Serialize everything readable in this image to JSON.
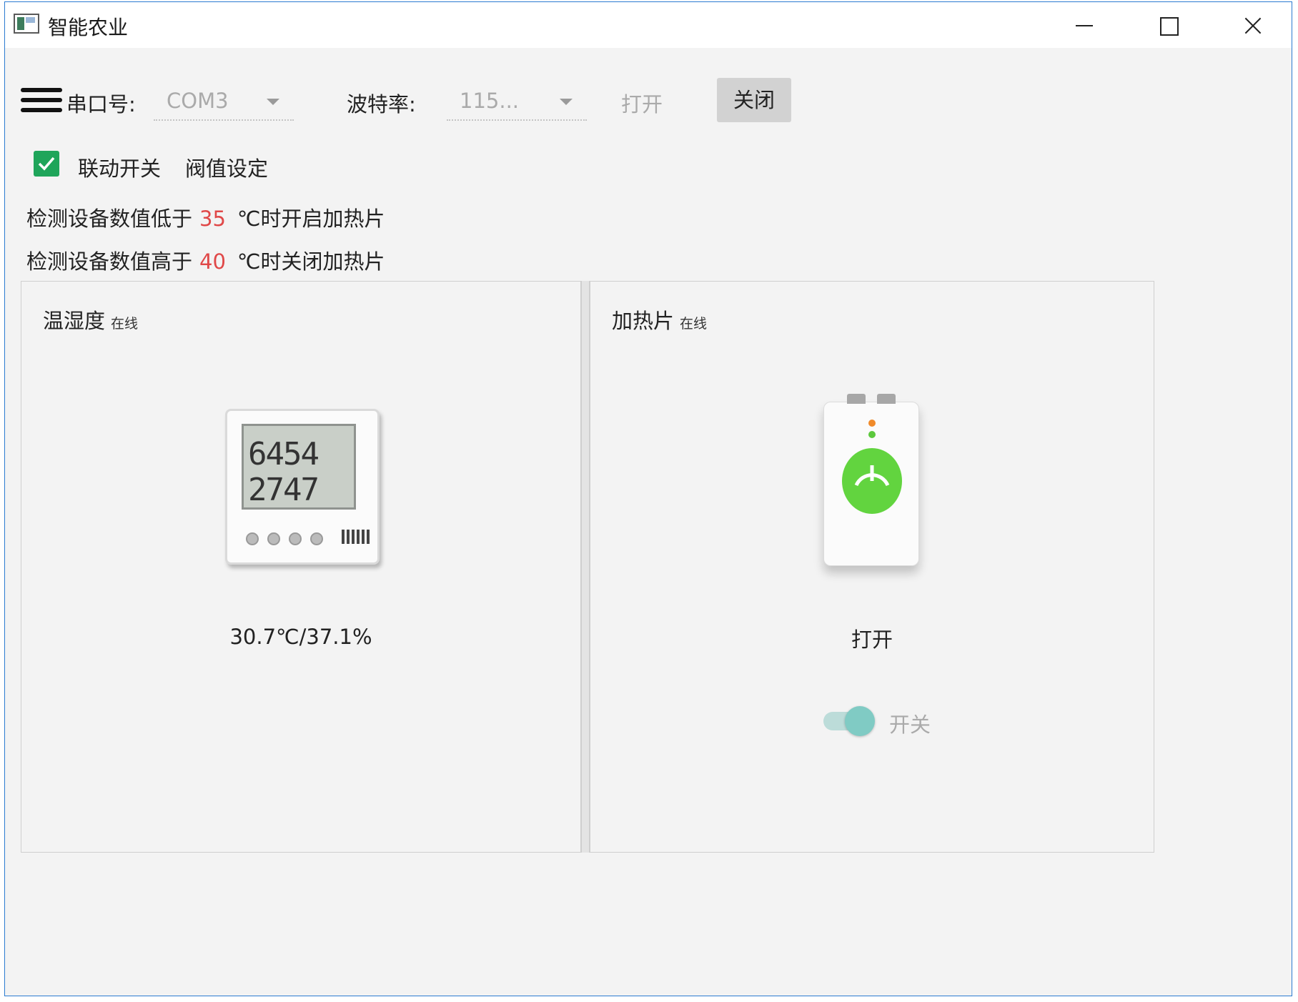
{
  "window": {
    "title": "智能农业"
  },
  "toolbar": {
    "port_label": "串口号:",
    "port_value": "COM3",
    "baud_label": "波特率:",
    "baud_value": "115...",
    "open_label": "打开",
    "close_label": "关闭"
  },
  "linkage": {
    "checkbox_checked": true,
    "checkbox_label": "联动开关",
    "threshold_label": "阀值设定"
  },
  "rules": [
    {
      "prefix": "检测设备数值低于",
      "value": "35",
      "suffix": "℃时开启加热片"
    },
    {
      "prefix": "检测设备数值高于",
      "value": "40",
      "suffix": "℃时关闭加热片"
    }
  ],
  "devices": {
    "sensor": {
      "name": "温湿度",
      "status": "在线",
      "lcd_line1": "6454",
      "lcd_line2": "2747",
      "reading": "30.7℃/37.1%"
    },
    "heater": {
      "name": "加热片",
      "status": "在线",
      "state": "打开",
      "switch_label": "开关",
      "switch_on": true
    }
  },
  "colors": {
    "accent_green": "#1fa55a",
    "threshold_red": "#e04848",
    "toggle_teal": "#80cbc4"
  }
}
